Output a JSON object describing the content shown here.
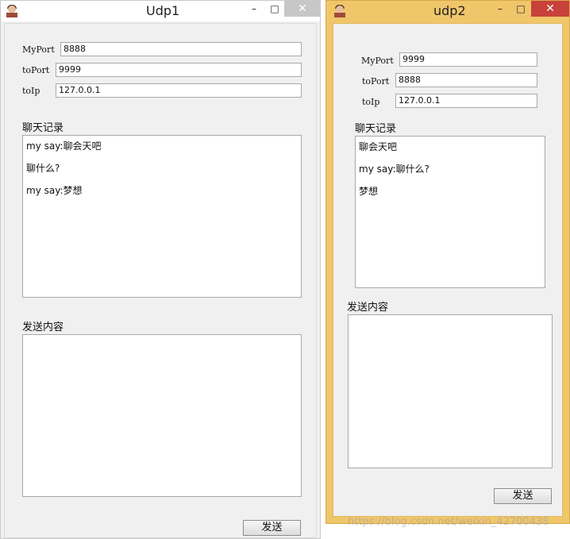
{
  "win1": {
    "title": "Udp1",
    "minimize": "–",
    "maximize": "□",
    "close": "✕",
    "fields": {
      "myport_label": "MyPort",
      "myport_value": "8888",
      "toport_label": "toPort",
      "toport_value": "9999",
      "toip_label": "toIp",
      "toip_value": "127.0.0.1"
    },
    "chat_label": "聊天记录",
    "messages": [
      "my say:聊会天吧",
      "聊什么?",
      "my say:梦想"
    ],
    "send_label": "发送内容",
    "send_button": "发送"
  },
  "win2": {
    "title": "udp2",
    "minimize": "–",
    "maximize": "□",
    "close": "✕",
    "fields": {
      "myport_label": "MyPort",
      "myport_value": "9999",
      "toport_label": "toPort",
      "toport_value": "8888",
      "toip_label": "toIp",
      "toip_value": "127.0.0.1"
    },
    "chat_label": "聊天记录",
    "messages": [
      "聊会天吧",
      "my say:聊什么?",
      "梦想"
    ],
    "send_label": "发送内容",
    "send_button": "发送"
  },
  "watermark": "https://blog.csdn.net/weixin_42700438"
}
